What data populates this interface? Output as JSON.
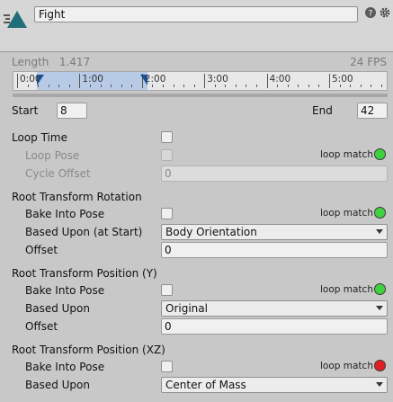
{
  "header": {
    "clip_name": "Fight",
    "help_icon": "question-icon",
    "settings_icon": "gear-icon"
  },
  "clip_info": {
    "length_label": "Length",
    "length_value": "1.417",
    "fps": "24 FPS"
  },
  "timeline": {
    "labels": [
      "0:00",
      "1:00",
      "2:00",
      "3:00",
      "4:00",
      "5:00"
    ],
    "start_marker_icon": "range-start-marker-icon",
    "end_marker_icon": "range-end-marker-icon"
  },
  "range": {
    "start_label": "Start",
    "start_value": "8",
    "end_label": "End",
    "end_value": "42"
  },
  "loop": {
    "loop_time_label": "Loop Time",
    "loop_pose_label": "Loop Pose",
    "loop_pose_match": "loop match",
    "cycle_offset_label": "Cycle Offset",
    "cycle_offset_value": "0"
  },
  "rotation": {
    "heading": "Root Transform Rotation",
    "bake_label": "Bake Into Pose",
    "loop_match": "loop match",
    "based_upon_label": "Based Upon (at Start)",
    "based_upon_value": "Body Orientation",
    "offset_label": "Offset",
    "offset_value": "0"
  },
  "position_y": {
    "heading": "Root Transform Position (Y)",
    "bake_label": "Bake Into Pose",
    "loop_match": "loop match",
    "based_upon_label": "Based Upon",
    "based_upon_value": "Original",
    "offset_label": "Offset",
    "offset_value": "0"
  },
  "position_xz": {
    "heading": "Root Transform Position (XZ)",
    "bake_label": "Bake Into Pose",
    "loop_match": "loop match",
    "based_upon_label": "Based Upon",
    "based_upon_value": "Center of Mass"
  },
  "colors": {
    "match_green": "#3fd13f",
    "match_red": "#e02020",
    "asset_icon_teal": "#1f6e78",
    "range_highlight": "#b7cbe6"
  }
}
